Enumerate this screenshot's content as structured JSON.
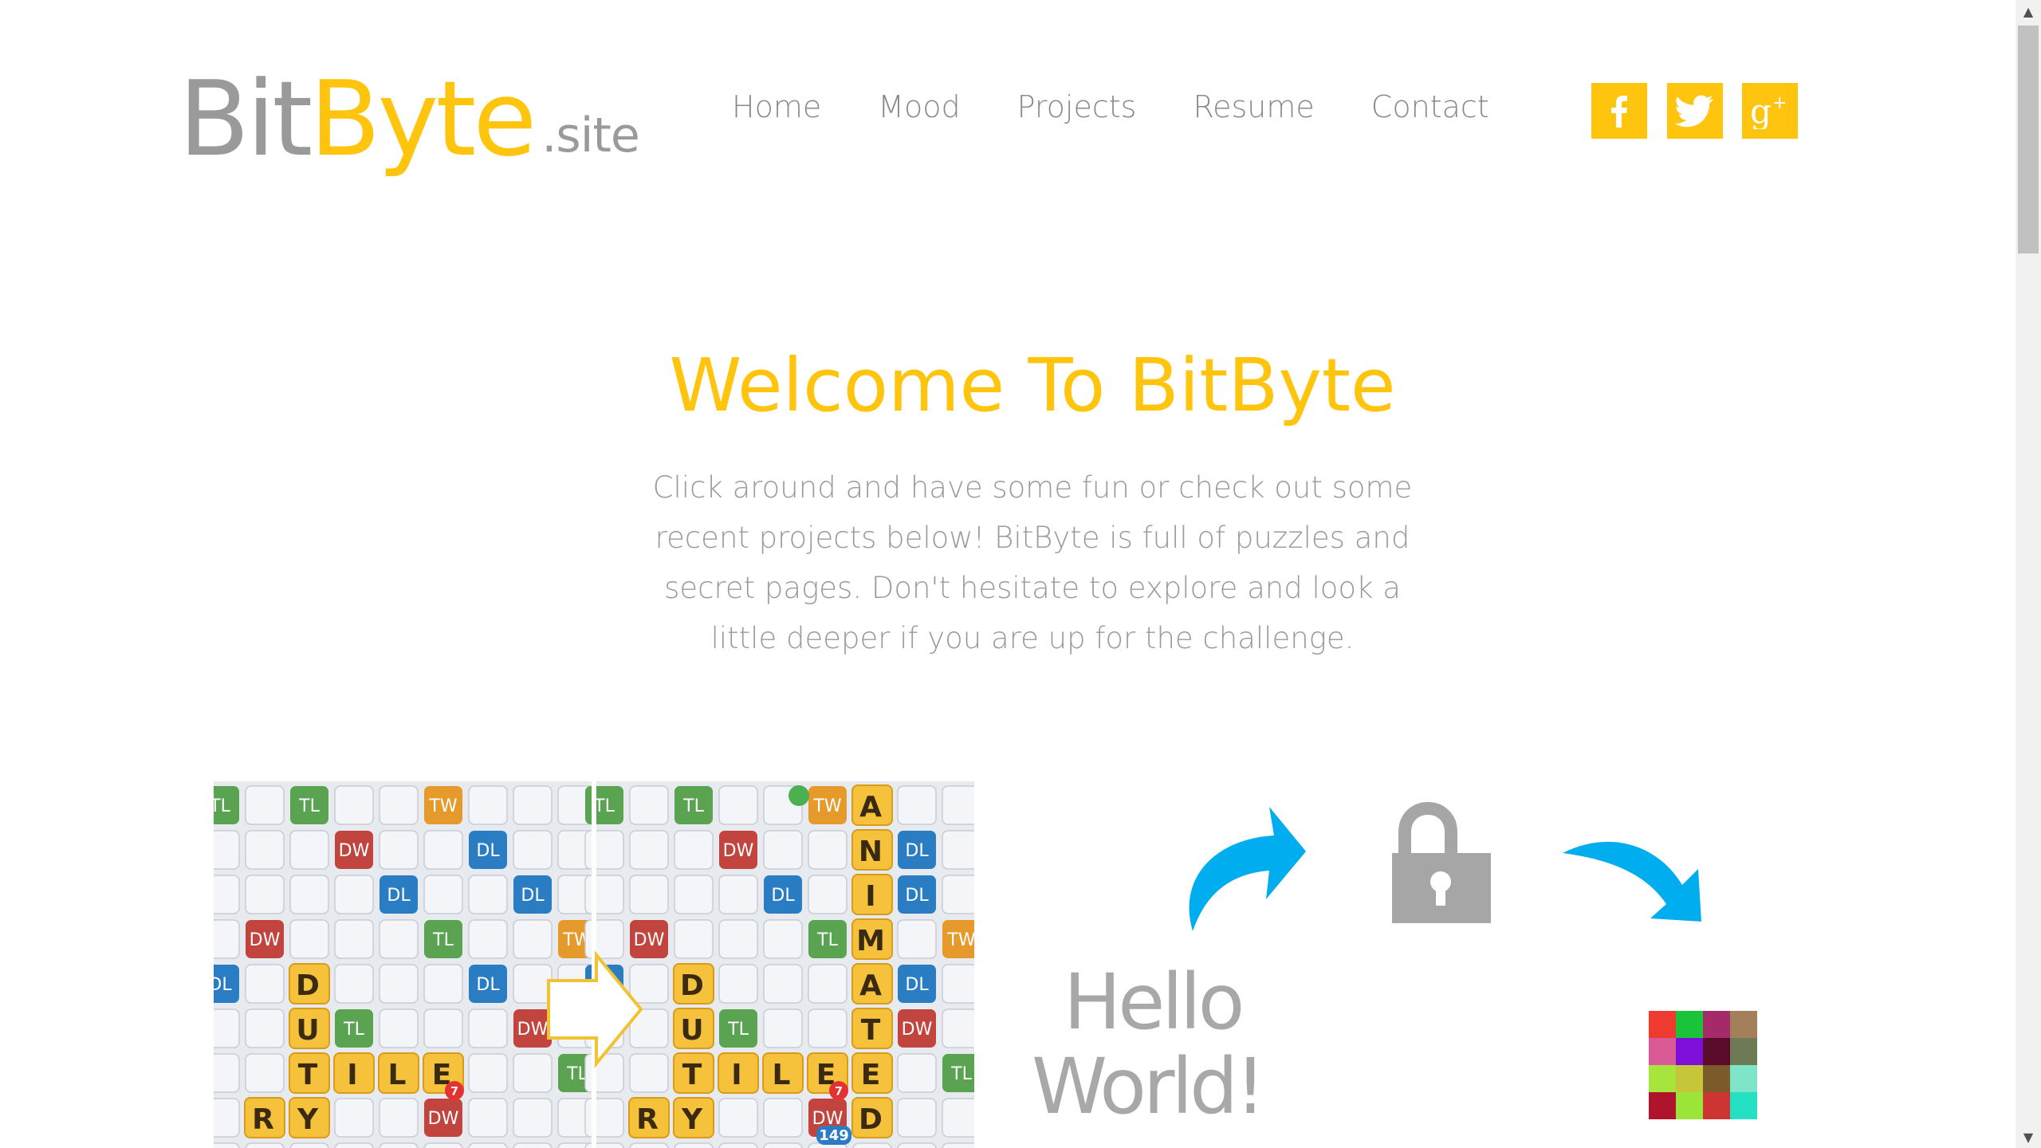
{
  "logo": {
    "part1": "Bit",
    "part2": "Byte",
    "suffix": ".site"
  },
  "nav": [
    {
      "label": "Home"
    },
    {
      "label": "Mood"
    },
    {
      "label": "Projects"
    },
    {
      "label": "Resume"
    },
    {
      "label": "Contact"
    }
  ],
  "social": [
    {
      "icon": "facebook-icon"
    },
    {
      "icon": "twitter-icon"
    },
    {
      "icon": "google-plus-icon"
    }
  ],
  "hero": {
    "title": "Welcome To BitByte",
    "text": "Click around and have some fun or check out some recent projects below! BitByte is full of puzzles and secret pages. Don't hesitate to explore and look a little deeper if you are up for the challenge."
  },
  "projects": {
    "board": {
      "tiles_left": [
        "D",
        "U",
        "T",
        "I",
        "L",
        "E",
        "R",
        "Y"
      ],
      "tiles_right_vertical": [
        "A",
        "N",
        "I",
        "M",
        "A",
        "T",
        "E",
        "D"
      ],
      "bonus_labels": [
        "TL",
        "TW",
        "DW",
        "DL"
      ],
      "badges": [
        "7",
        "149"
      ]
    },
    "secret": {
      "text_line1": "Hello",
      "text_line2": "World!"
    }
  },
  "colors": {
    "brand_yellow": "#fec40e",
    "text_gray": "#9a9a9a",
    "arrow_blue": "#00aeef",
    "lock_gray": "#a6a6a6"
  },
  "icons": {
    "scroll_up": "▲",
    "scroll_down": "▼"
  }
}
